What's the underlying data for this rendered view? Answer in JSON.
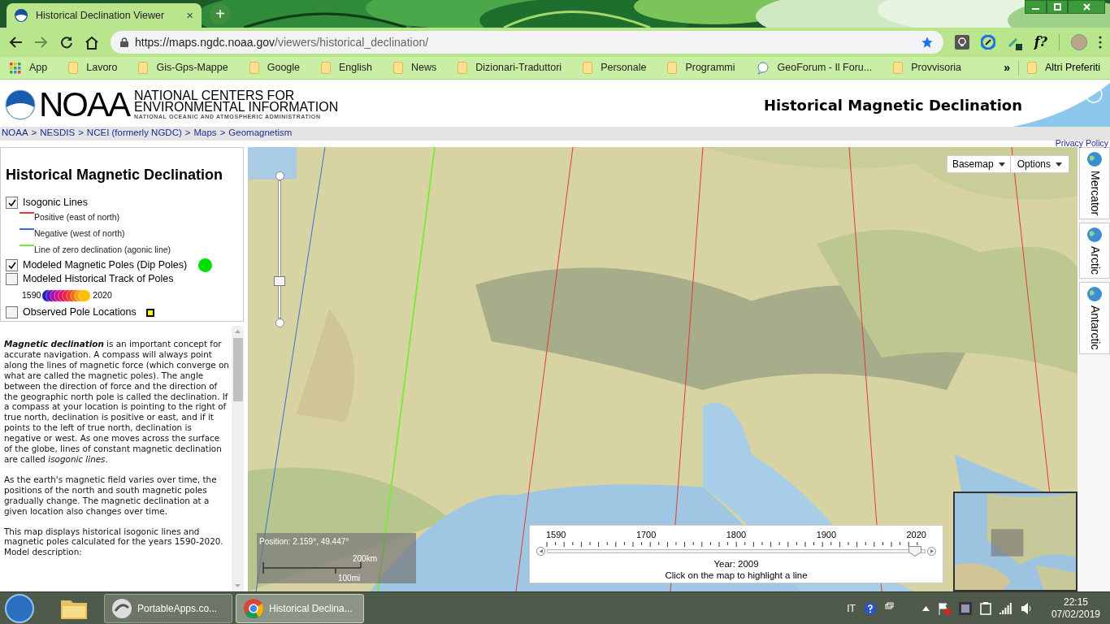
{
  "browser": {
    "tab": {
      "title": "Historical Declination Viewer",
      "close": "×"
    },
    "new_tab": "+",
    "url": {
      "host": "https://maps.ngdc.noaa.gov",
      "path": "/viewers/historical_declination/"
    },
    "extension_label": "f?",
    "bookmarks": [
      {
        "label": "App",
        "kind": "apps"
      },
      {
        "label": "Lavoro",
        "kind": "folder"
      },
      {
        "label": "Gis-Gps-Mappe",
        "kind": "folder"
      },
      {
        "label": "Google",
        "kind": "folder"
      },
      {
        "label": "English",
        "kind": "folder"
      },
      {
        "label": "News",
        "kind": "folder"
      },
      {
        "label": "Dizionari-Traduttori",
        "kind": "folder"
      },
      {
        "label": "Personale",
        "kind": "folder"
      },
      {
        "label": "Programmi",
        "kind": "folder"
      },
      {
        "label": "GeoForum - Il Foru...",
        "kind": "site"
      },
      {
        "label": "Provvisoria",
        "kind": "folder"
      }
    ],
    "overflow": "»",
    "other_bookmarks": "Altri Preferiti"
  },
  "header": {
    "org": "NOAA",
    "title_line1": "NATIONAL CENTERS FOR",
    "title_line2": "ENVIRONMENTAL INFORMATION",
    "subtitle": "NATIONAL OCEANIC AND ATMOSPHERIC ADMINISTRATION",
    "page_title": "Historical Magnetic Declination"
  },
  "breadcrumb": {
    "separator": ">",
    "items": [
      "NOAA",
      "NESDIS",
      "NCEI (formerly NGDC)",
      "Maps",
      "Geomagnetism"
    ]
  },
  "privacy_link": "Privacy Policy",
  "layers": {
    "title": "Historical Magnetic Declination",
    "items": [
      {
        "kind": "checkbox",
        "label": "Isogonic Lines",
        "checked": true
      },
      {
        "kind": "legend_line",
        "label": "Positive (east of north)",
        "color": "#e53935"
      },
      {
        "kind": "legend_line",
        "label": "Negative (west of north)",
        "color": "#3a6fd8"
      },
      {
        "kind": "legend_line",
        "label": "Line of zero declination (agonic line)",
        "color": "#7ee83f"
      },
      {
        "kind": "checkbox_dot",
        "label": "Modeled Magnetic Poles (Dip Poles)",
        "checked": true,
        "color": "#00e000"
      },
      {
        "kind": "checkbox",
        "label": "Modeled Historical Track of Poles",
        "checked": false
      },
      {
        "kind": "year_scale",
        "start": "1590",
        "end": "2020"
      },
      {
        "kind": "checkbox_square",
        "label": "Observed Pole Locations",
        "checked": false,
        "color": "#ffff00"
      }
    ]
  },
  "description": [
    "**Magnetic declination** is an important concept for accurate navigation. A compass will always point along the lines of magnetic force (which converge on what are called the magnetic poles). The angle between the direction of force and the direction of the geographic north pole is called the declination. If a compass at your location is pointing to the right of true north, declination is positive or east, and if it points to the left of true north, declination is negative or west. As one moves across the surface of the globe, lines of constant magnetic declination are called *isogonic lines*.",
    "As the earth's magnetic field varies over time, the positions of the north and south magnetic poles gradually change. The magnetic declination at a given location also changes over time.",
    "This map displays historical isogonic lines and magnetic poles calculated for the years 1590-2020.",
    "Model description:"
  ],
  "map": {
    "basemap": "Basemap",
    "options": "Options",
    "zoom": {
      "level": 0.27
    },
    "position": "Position: 2.159°, 49.447°",
    "scale_km": "200km",
    "scale_mi": "100mi",
    "time_slider": {
      "ticks": [
        "1590",
        "1700",
        "1800",
        "1900",
        "2020"
      ],
      "level": 0.974,
      "year": "Year: 2009",
      "hint": "Click on the map to highlight a line"
    }
  },
  "projections": [
    {
      "label": "Mercator"
    },
    {
      "label": "Arctic"
    },
    {
      "label": "Antarctic"
    }
  ],
  "taskbar": {
    "apps": [
      {
        "label": "PortableApps.co...",
        "selected": false,
        "kind": "portable"
      },
      {
        "label": "Historical Declina...",
        "selected": true,
        "kind": "chrome"
      }
    ],
    "language": "IT",
    "time": "22:15",
    "date": "07/02/2019"
  }
}
